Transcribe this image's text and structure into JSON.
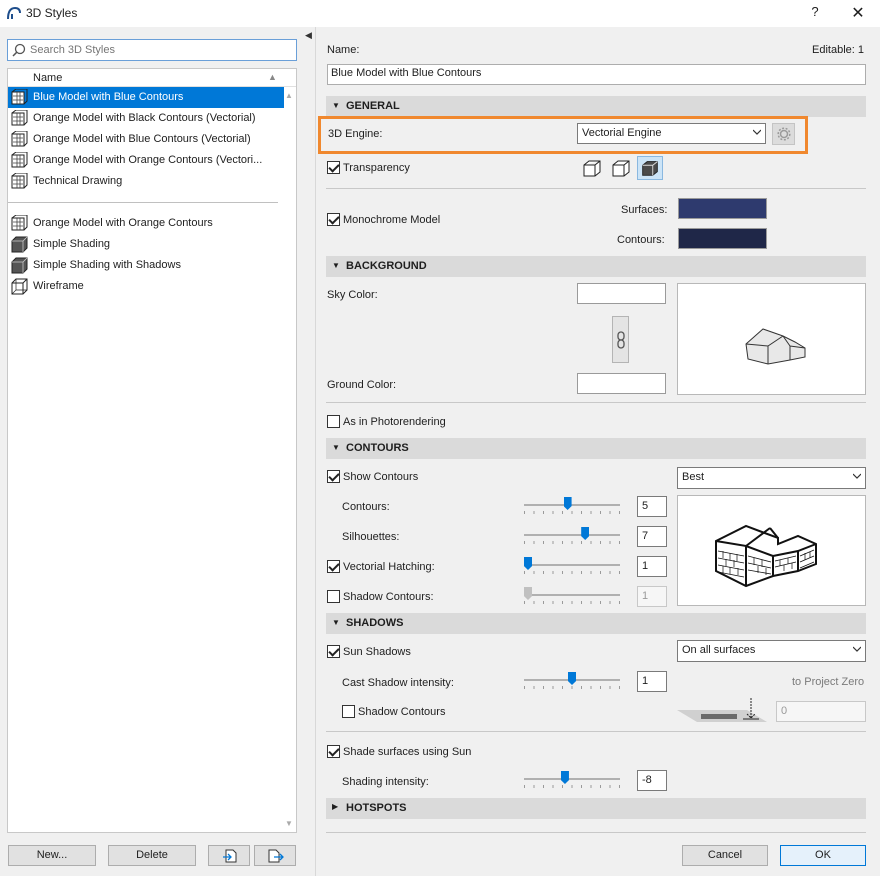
{
  "window": {
    "title": "3D Styles",
    "help": "?",
    "close": "✕"
  },
  "search": {
    "placeholder": "Search 3D Styles"
  },
  "list": {
    "header": "Name",
    "group1": [
      {
        "label": "Blue Model with Blue Contours",
        "icon": "vectorial-style-icon",
        "selected": true
      },
      {
        "label": "Orange Model with Black Contours (Vectorial)",
        "icon": "vectorial-style-icon"
      },
      {
        "label": "Orange Model with Blue Contours (Vectorial)",
        "icon": "vectorial-style-icon"
      },
      {
        "label": "Orange Model with Orange Contours (Vectori...",
        "icon": "vectorial-style-icon"
      },
      {
        "label": "Technical Drawing",
        "icon": "vectorial-style-icon"
      }
    ],
    "group2": [
      {
        "label": "Orange Model with Orange Contours",
        "icon": "vectorial-style-icon"
      },
      {
        "label": "Simple Shading",
        "icon": "shaded-style-icon"
      },
      {
        "label": "Simple Shading with Shadows",
        "icon": "shaded-style-icon"
      },
      {
        "label": "Wireframe",
        "icon": "wireframe-style-icon"
      }
    ]
  },
  "left_buttons": {
    "new": "New...",
    "delete": "Delete"
  },
  "name": {
    "label": "Name:",
    "editable": "Editable: 1",
    "value": "Blue Model with Blue Contours"
  },
  "general": {
    "title": "GENERAL",
    "engine_label": "3D Engine:",
    "engine_value": "Vectorial Engine",
    "transparency": "Transparency",
    "monochrome": "Monochrome Model",
    "surfaces_label": "Surfaces:",
    "contours_label": "Contours:",
    "surfaces_color": "#2e3a6e",
    "contours_color": "#1f2748"
  },
  "background": {
    "title": "BACKGROUND",
    "sky_label": "Sky Color:",
    "ground_label": "Ground Color:",
    "photorender": "As in Photorendering"
  },
  "contours": {
    "title": "CONTOURS",
    "show": "Show Contours",
    "quality": "Best",
    "contours_label": "Contours:",
    "contours_value": "5",
    "contours_level": 0.45,
    "silhouettes_label": "Silhouettes:",
    "silhouettes_value": "7",
    "silhouettes_level": 0.65,
    "hatching_label": "Vectorial Hatching:",
    "hatching_value": "1",
    "hatching_level": 0,
    "shadow_contours_label": "Shadow Contours:",
    "shadow_contours_value": "1",
    "shadow_contours_level": 0
  },
  "shadows": {
    "title": "SHADOWS",
    "sun": "Sun Shadows",
    "surfaces": "On all surfaces",
    "cast_label": "Cast Shadow intensity:",
    "cast_value": "1",
    "cast_level": 0.5,
    "to_zero": "to Project Zero",
    "shadow_contours": "Shadow Contours",
    "zero_value": "0",
    "shade_sun": "Shade surfaces using Sun",
    "shading_label": "Shading intensity:",
    "shading_value": "-8",
    "shading_level": 0.42
  },
  "hotspots": {
    "title": "HOTSPOTS"
  },
  "footer": {
    "cancel": "Cancel",
    "ok": "OK"
  },
  "highlight_color": "#f0882e",
  "selection_color": "#0078d7"
}
